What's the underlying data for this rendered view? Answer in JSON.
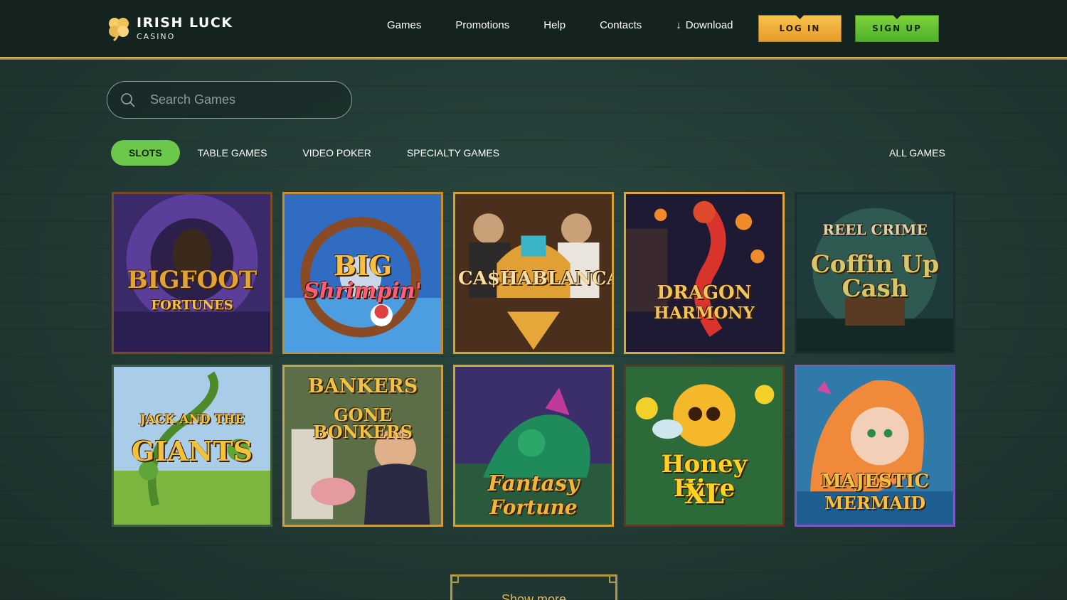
{
  "header": {
    "logo_title": "IRISH LUCK",
    "logo_subtitle": "CASINO",
    "nav": [
      "Games",
      "Promotions",
      "Help",
      "Contacts"
    ],
    "download_label": "Download",
    "login_label": "LOG IN",
    "signup_label": "SIGN UP"
  },
  "search": {
    "placeholder": "Search Games"
  },
  "tabs": [
    "SLOTS",
    "TABLE GAMES",
    "VIDEO POKER",
    "SPECIALTY GAMES"
  ],
  "all_games_label": "ALL GAMES",
  "games": [
    {
      "title": "BIGFOOT",
      "subtitle": "FORTUNES"
    },
    {
      "title": "BIG",
      "subtitle": "Shrimpin'"
    },
    {
      "title": "CA$HABLANCA",
      "subtitle": ""
    },
    {
      "title": "DRAGON",
      "subtitle": "HARMONY"
    },
    {
      "title": "REEL CRIME",
      "subtitle": "Coffin Up Cash"
    },
    {
      "title": "JACK AND THE",
      "subtitle": "GIANTS"
    },
    {
      "title": "BANKERS",
      "subtitle": "GONE BONKERS"
    },
    {
      "title": "Fantasy",
      "subtitle": "Fortune"
    },
    {
      "title": "Honey Hive",
      "subtitle": "XL"
    },
    {
      "title": "MAJESTIC",
      "subtitle": "MERMAID"
    }
  ],
  "show_more_label": "Show more",
  "colors": {
    "accent_gold": "#d8a233",
    "active_tab_green": "#6cc84b",
    "login_orange": "#f0b03b",
    "signup_green": "#6cc33a"
  }
}
